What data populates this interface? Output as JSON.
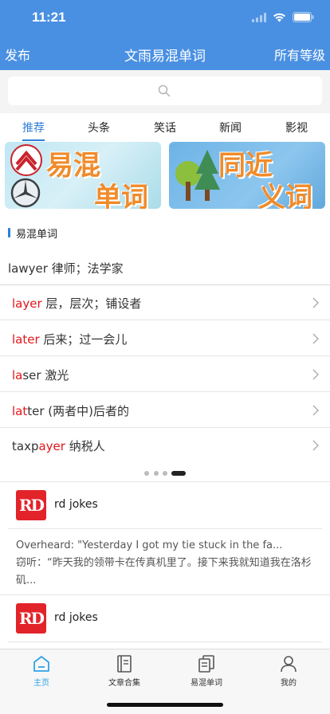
{
  "status": {
    "time": "11:21"
  },
  "nav": {
    "left": "发布",
    "title": "文雨易混单词",
    "right": "所有等级"
  },
  "search": {
    "placeholder": ""
  },
  "tabs": [
    {
      "label": "推荐",
      "active": true
    },
    {
      "label": "头条",
      "active": false
    },
    {
      "label": "笑话",
      "active": false
    },
    {
      "label": "新闻",
      "active": false
    },
    {
      "label": "影视",
      "active": false
    }
  ],
  "banners": [
    {
      "line1": "易混",
      "line2": "单词"
    },
    {
      "line1": "同近",
      "line2": "义词"
    }
  ],
  "section": {
    "title": "易混单词"
  },
  "words": {
    "first": "lawyer 律师；法学家",
    "rows": [
      {
        "pre": "",
        "hl": "layer",
        "post": "",
        "meaning": " 层，层次；铺设者"
      },
      {
        "pre": "",
        "hl": "later",
        "post": "",
        "meaning": " 后来；过一会儿"
      },
      {
        "pre": "",
        "hl": "la",
        "post": "ser",
        "meaning": " 激光"
      },
      {
        "pre": "",
        "hl": "lat",
        "post": "ter",
        "meaning": " (两者中)后者的"
      },
      {
        "pre": "taxp",
        "hl": "ayer",
        "post": "",
        "meaning": " 纳税人"
      }
    ]
  },
  "carousel": {
    "count": 4,
    "active_index": 3
  },
  "jokes": [
    {
      "logo": "RD",
      "source": "rd jokes",
      "text_en": "Overheard: \"Yesterday I got my tie stuck in the fa...",
      "text_cn": "窃听：“昨天我的领带卡在传真机里了。接下来我就知道我在洛杉矶..."
    },
    {
      "logo": "RD",
      "source": "rd jokes"
    }
  ],
  "tabbar": [
    {
      "label": "主页",
      "icon": "home-icon",
      "active": true
    },
    {
      "label": "文章合集",
      "icon": "book-icon",
      "active": false
    },
    {
      "label": "易混单词",
      "icon": "documents-icon",
      "active": false
    },
    {
      "label": "我的",
      "icon": "person-icon",
      "active": false
    }
  ],
  "colors": {
    "header": "#4a90e2",
    "accent": "#2f7fd8",
    "highlight": "#e0161a",
    "tab_active": "#2fa3e6",
    "rd_red": "#e2242a"
  }
}
